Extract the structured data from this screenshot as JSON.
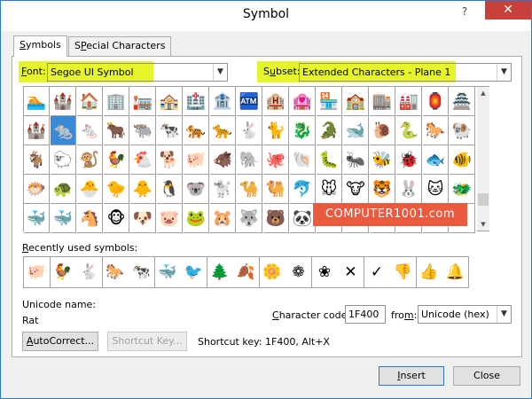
{
  "window": {
    "title": "Symbol",
    "help_label": "?",
    "close_label": "✕"
  },
  "tabs": [
    {
      "label": "Symbols",
      "key": "S",
      "rest": "ymbols"
    },
    {
      "label": "Special Characters",
      "key": "P",
      "pre": "S",
      "rest": "ecial Characters"
    }
  ],
  "font": {
    "label_key": "F",
    "label_rest": "ont:",
    "value": "Segoe UI Symbol"
  },
  "subset": {
    "label_key": "u",
    "label_pre": "S",
    "label_rest": "bset:",
    "value": "Extended Characters - Plane 1"
  },
  "symbols": [
    [
      "🏊",
      "🏰",
      "🏠",
      "🏢",
      "🏣",
      "🏤",
      "🏥",
      "🏦",
      "🏧",
      "🏨",
      "🏩",
      "🏪",
      "🏫",
      "🏬",
      "🏭",
      "🏮",
      "🏯"
    ],
    [
      "🏰",
      "🐀",
      "🐁",
      "🐂",
      "🐃",
      "🐄",
      "🐅",
      "🐆",
      "🐇",
      "🐈",
      "🐉",
      "🐊",
      "🐋",
      "🐌",
      "🐍",
      "🐎",
      "🐏"
    ],
    [
      "🐐",
      "🐑",
      "🐒",
      "🐓",
      "🐔",
      "🐕",
      "🐖",
      "🐗",
      "🐘",
      "🐙",
      "🐚",
      "🐛",
      "🐜",
      "🐝",
      "🐞",
      "🐟",
      "🐠"
    ],
    [
      "🐡",
      "🐢",
      "🐣",
      "🐤",
      "🐥",
      "🐧",
      "🐨",
      "🐩",
      "🐪",
      "🐫",
      "🐬",
      "🐭",
      "🐮",
      "🐯",
      "🐰",
      "🐱",
      "🐲"
    ],
    [
      "🐳",
      "🐳",
      "🐴",
      "🐵",
      "🐶",
      "🐷",
      "🐸",
      "🐹",
      "🐺",
      "🐻",
      "🐼",
      "",
      "",
      "",
      "",
      "",
      ""
    ]
  ],
  "selected": {
    "row": 1,
    "col": 1
  },
  "watermark": "COMPUTER1001.com",
  "recent": {
    "label_key": "R",
    "label_rest": "ecently used symbols:",
    "items": [
      "🐖",
      "🐓",
      "🐇",
      "🐎",
      "🐄",
      "🐳",
      "🐦",
      "🌲",
      "🍂",
      "🌼",
      "❁",
      "❀",
      "✕",
      "✓",
      "👎",
      "👍",
      "🔔"
    ]
  },
  "unicode_name_label": "Unicode name:",
  "unicode_name_value": "Rat",
  "character_code": {
    "label_key": "C",
    "label_rest": "haracter code:",
    "value": "1F400"
  },
  "from": {
    "label_key": "m",
    "label_pre": "fro",
    "label_rest": ":",
    "value": "Unicode (hex)"
  },
  "buttons": {
    "autocorrect": {
      "key": "A",
      "rest": "utoCorrect..."
    },
    "shortcut_key": "Shortcut Key...",
    "insert": {
      "key": "I",
      "rest": "nsert"
    },
    "close": "Close"
  },
  "shortcut_info": "Shortcut key: 1F400, Alt+X"
}
